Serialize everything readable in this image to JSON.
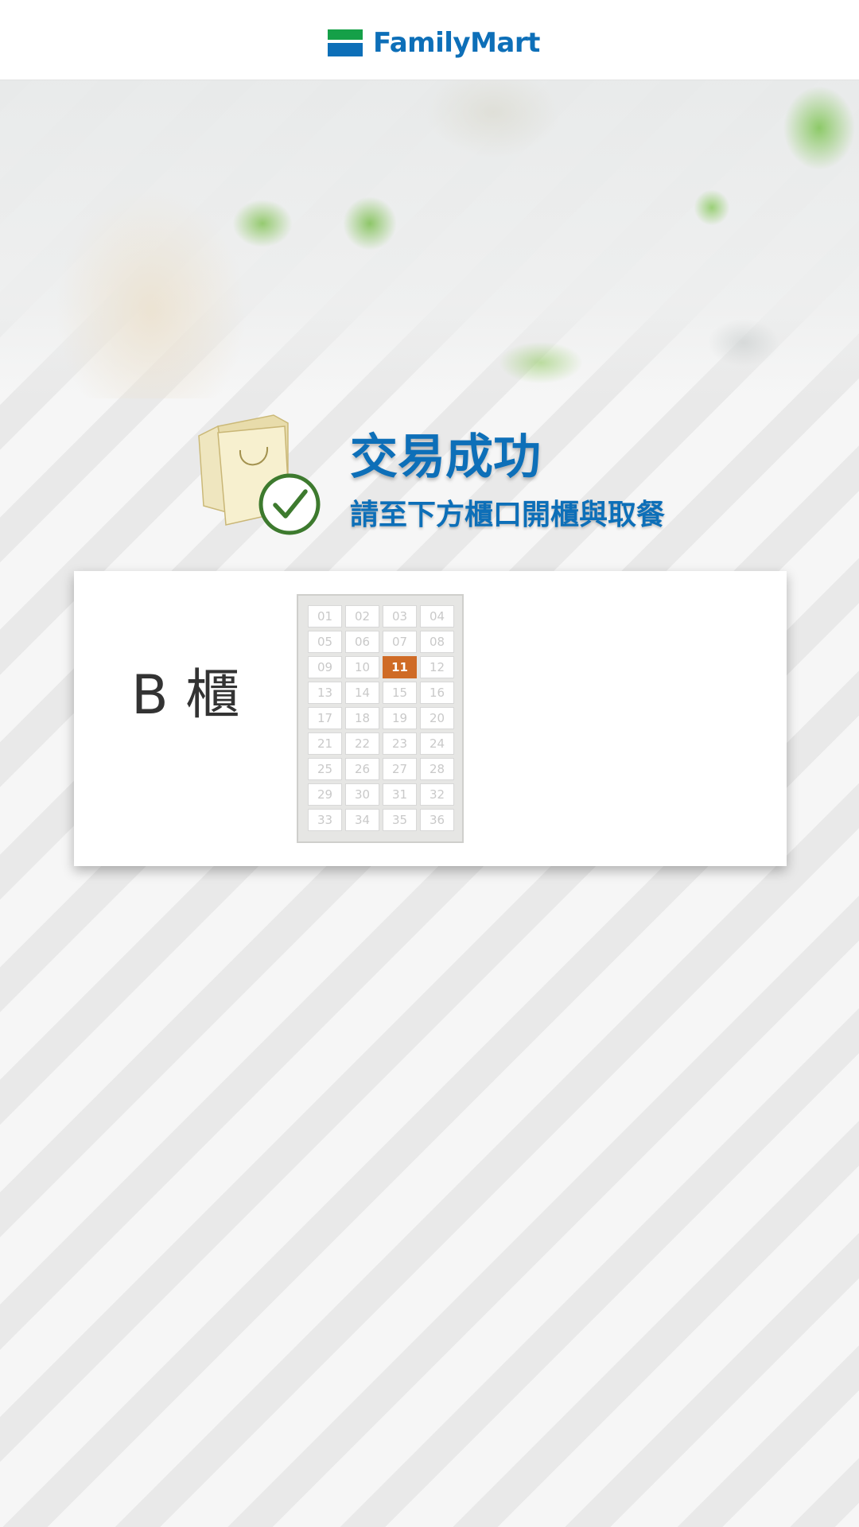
{
  "brand": {
    "name": "FamilyMart",
    "colors": {
      "blue": "#0d6fb8",
      "green": "#15a048"
    }
  },
  "message": {
    "title": "交易成功",
    "subtitle": "請至下方櫃口開櫃與取餐",
    "icon": "shopping-bag-check-icon"
  },
  "pickup": {
    "cabinet_label": "B 櫃",
    "selected_locker": "11",
    "highlight_color": "#cf6b26",
    "lockers": [
      "01",
      "02",
      "03",
      "04",
      "05",
      "06",
      "07",
      "08",
      "09",
      "10",
      "11",
      "12",
      "13",
      "14",
      "15",
      "16",
      "17",
      "18",
      "19",
      "20",
      "21",
      "22",
      "23",
      "24",
      "25",
      "26",
      "27",
      "28",
      "29",
      "30",
      "31",
      "32",
      "33",
      "34",
      "35",
      "36"
    ]
  }
}
